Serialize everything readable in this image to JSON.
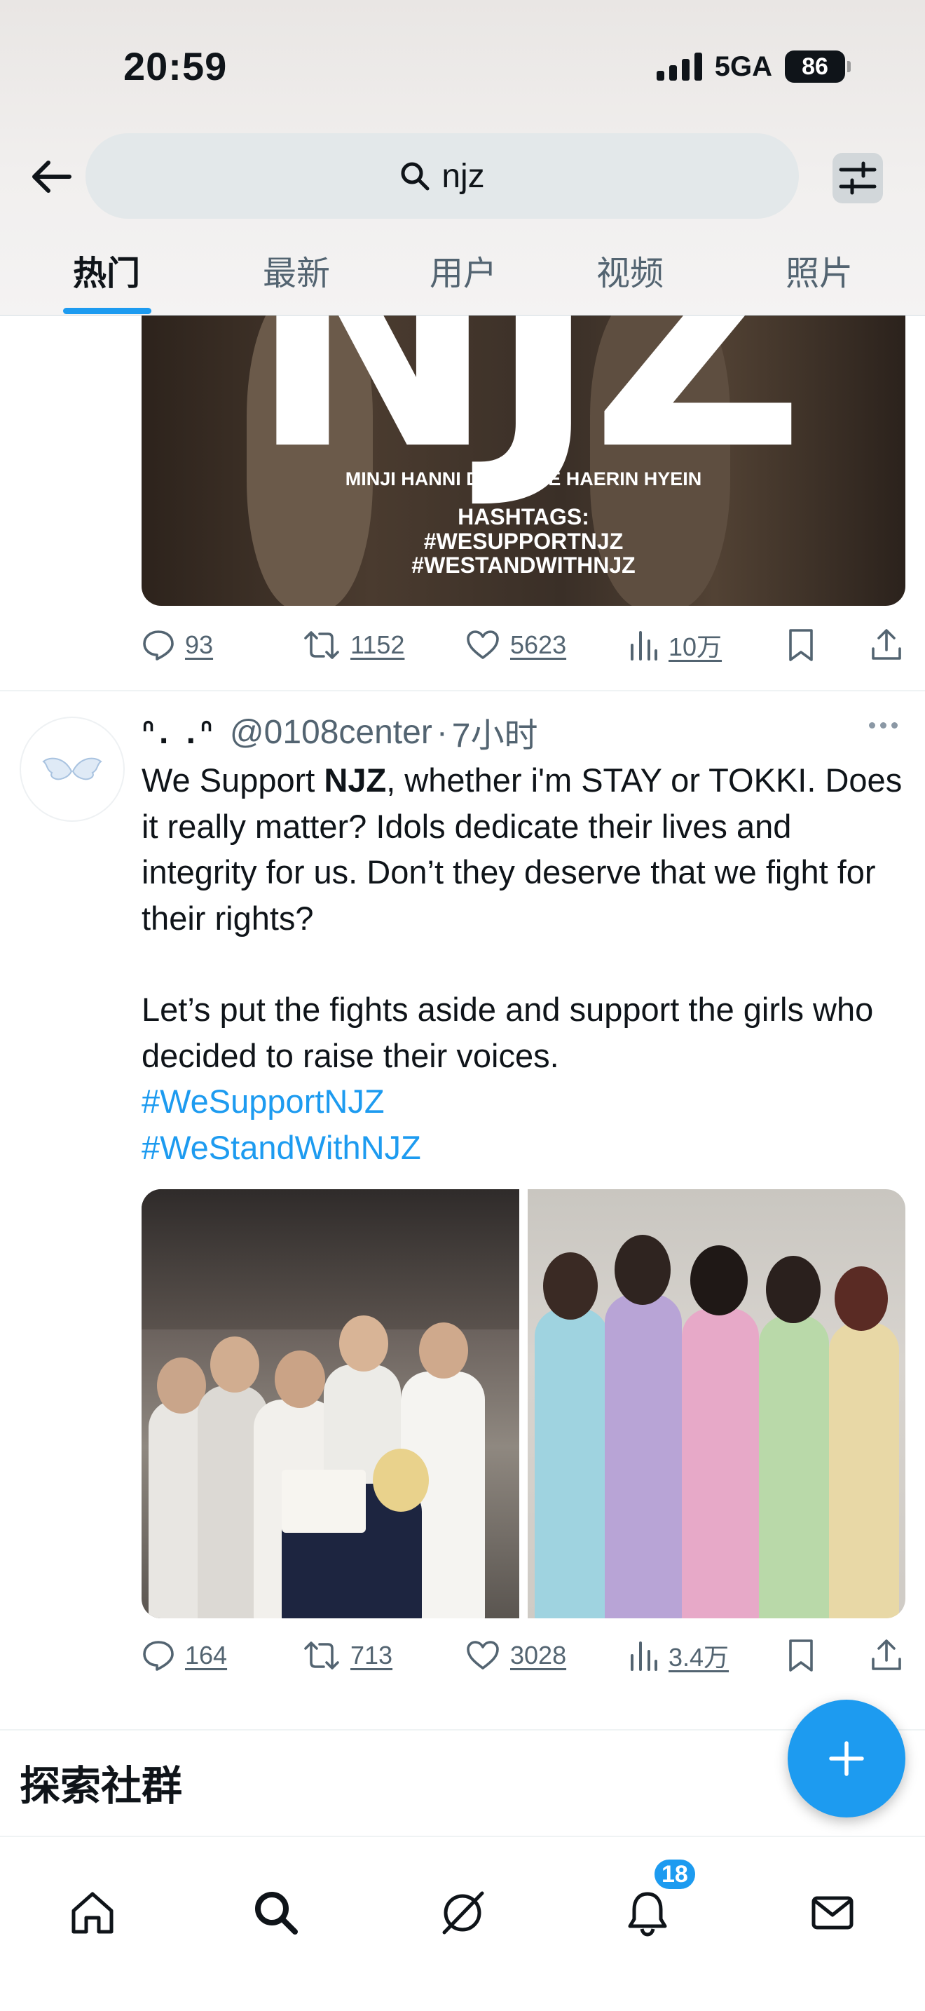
{
  "status_bar": {
    "time": "20:59",
    "network": "5GA",
    "battery": "86"
  },
  "search": {
    "query": "njz"
  },
  "tabs": [
    {
      "label": "热门",
      "active": true
    },
    {
      "label": "最新",
      "active": false
    },
    {
      "label": "用户",
      "active": false
    },
    {
      "label": "视频",
      "active": false
    },
    {
      "label": "照片",
      "active": false
    }
  ],
  "tweet1": {
    "media": {
      "title_text": "NJZ",
      "members": "MINJI HANNI DANIELLE HAERIN HYEIN",
      "hashtags_title": "HASHTAGS:",
      "hashtag_1": "#WESUPPORTNJZ",
      "hashtag_2": "#WESTANDWITHNJZ"
    },
    "replies": "93",
    "retweets": "1152",
    "likes": "5623",
    "views": "10万"
  },
  "tweet2": {
    "display_name": "ᐢ. .ᐢ",
    "handle": "@0108center",
    "separator": "·",
    "time": "7小时",
    "text_pre": "We Support ",
    "text_bold": "NJZ",
    "text_post": ", whether i'm STAY or TOKKI. Does it really matter? Idols dedicate their lives and integrity for us. Don’t they deserve that we fight for their rights?",
    "text_2": "Let’s put the fights aside and support the girls who decided to raise their voices.",
    "hashtag_1": "#WeSupportNJZ",
    "hashtag_2": "#WeStandWithNJZ",
    "replies": "164",
    "retweets": "713",
    "likes": "3028",
    "views": "3.4万"
  },
  "explore": {
    "title": "探索社群"
  },
  "bottom_nav": {
    "notifications_badge": "18"
  },
  "colors": {
    "accent": "#1d9bf0",
    "text": "#0f1419",
    "muted": "#536471"
  }
}
